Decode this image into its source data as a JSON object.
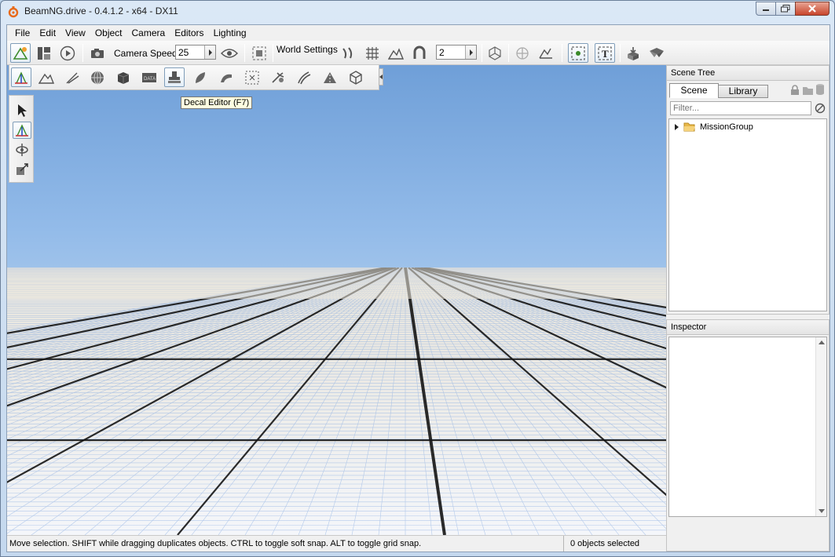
{
  "window": {
    "title": "BeamNG.drive - 0.4.1.2 - x64 - DX11"
  },
  "menu": [
    "File",
    "Edit",
    "View",
    "Object",
    "Camera",
    "Editors",
    "Lighting"
  ],
  "toolbar": {
    "camera_speed_label": "Camera Speed",
    "camera_speed_value": "25",
    "world_settings_label": "World Settings",
    "snap_value": "2"
  },
  "tooltip": "Decal Editor (F7)",
  "scene_tree": {
    "title": "Scene Tree",
    "tabs": [
      "Scene",
      "Library"
    ],
    "filter_placeholder": "Filter...",
    "items": [
      {
        "label": "MissionGroup",
        "icon": "folder-icon"
      }
    ]
  },
  "inspector": {
    "title": "Inspector"
  },
  "status": {
    "message": "Move selection.  SHIFT while dragging duplicates objects.  CTRL to toggle soft snap.  ALT to toggle grid snap.",
    "selection": "0 objects selected"
  },
  "colors": {
    "accent": "#7f9db9",
    "sky_top": "#6f9fd8",
    "grid_blue": "#3a74d6"
  }
}
